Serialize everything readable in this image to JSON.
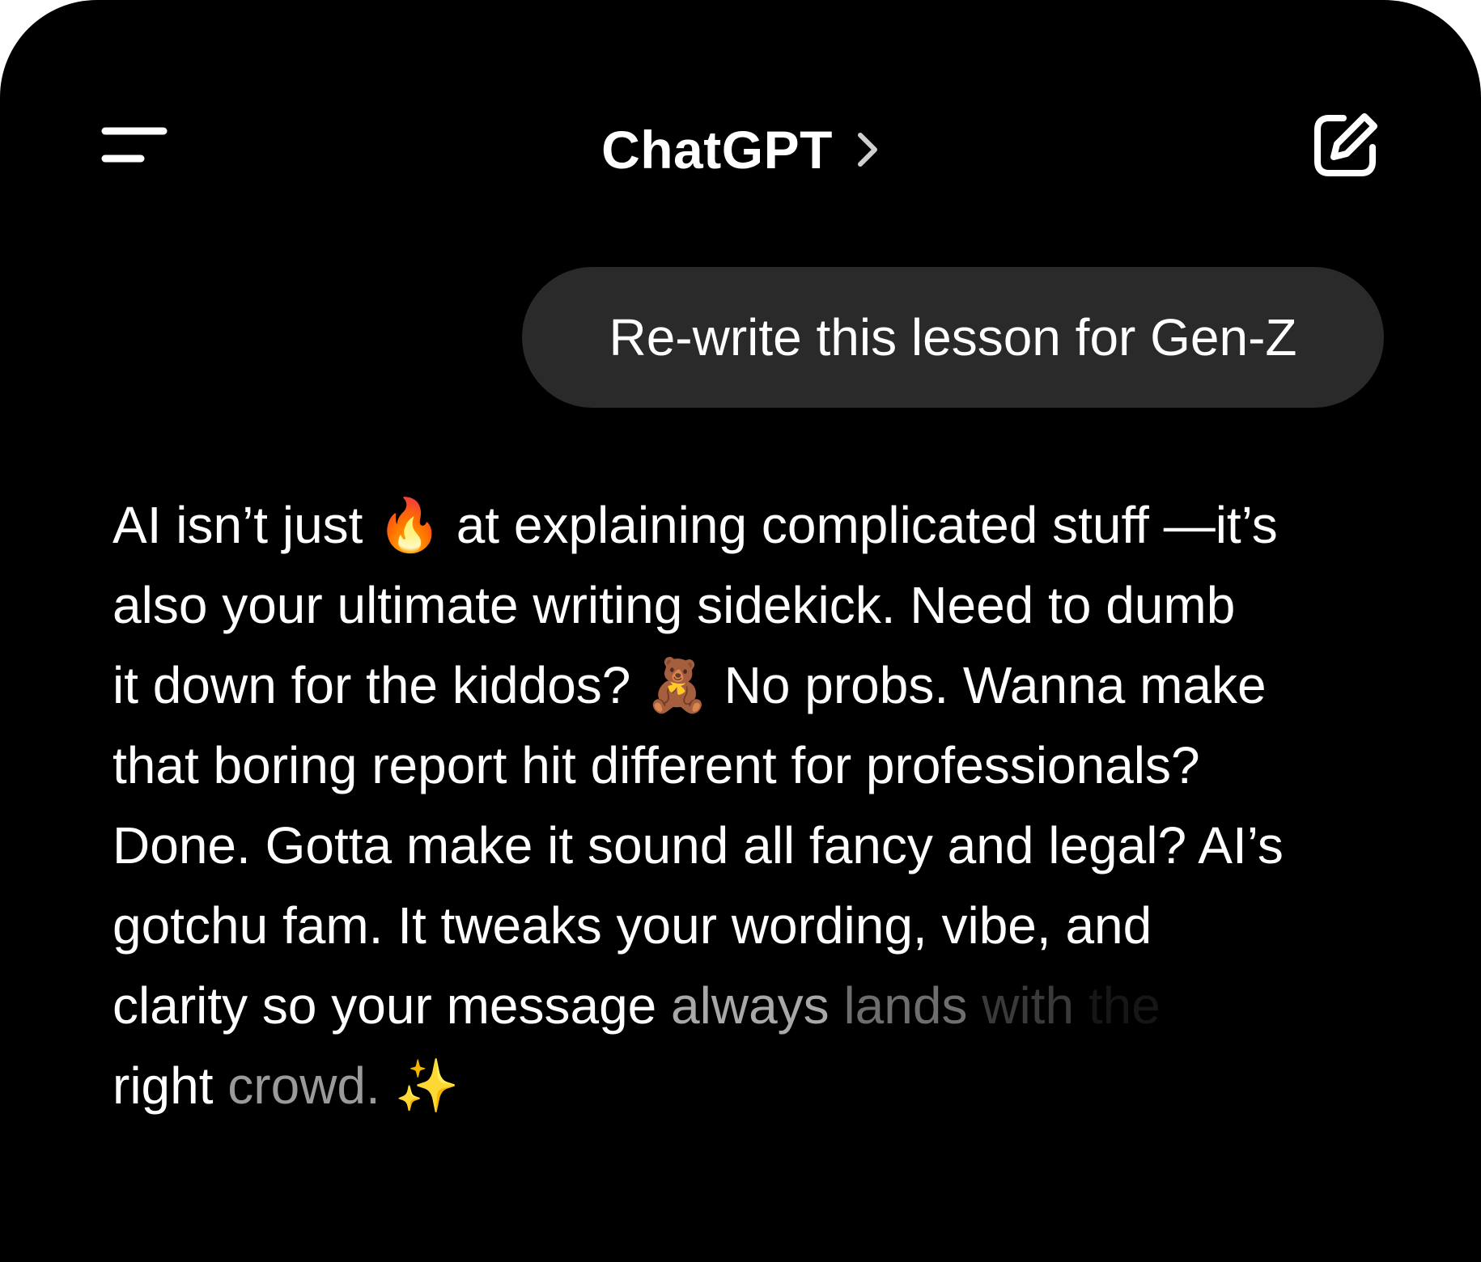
{
  "header": {
    "title": "ChatGPT",
    "menu_icon": "menu-icon",
    "chevron_icon": "chevron-right-icon",
    "new_chat_icon": "new-chat-icon"
  },
  "conversation": {
    "user_message": "Re-write this lesson for Gen-Z",
    "assistant_lines": {
      "l1": "AI isn’t just 🔥 at explaining complicated stuff —it’s",
      "l2": "also your ultimate writing sidekick. Need to dumb",
      "l3": "it down for the kiddos? 🧸 No probs. Wanna make",
      "l4": "that boring report hit different for professionals?",
      "l5": "Done. Gotta make it sound all fancy and legal? AI’s",
      "l6": "gotchu fam. It tweaks your wording, vibe, and",
      "l7a": "clarity so your message ",
      "l7b": "always ",
      "l7c": "lands ",
      "l7d": "with",
      "l7e": " the",
      "l8a": "right ",
      "l8b": "crowd. ",
      "l8c": "✨"
    }
  }
}
